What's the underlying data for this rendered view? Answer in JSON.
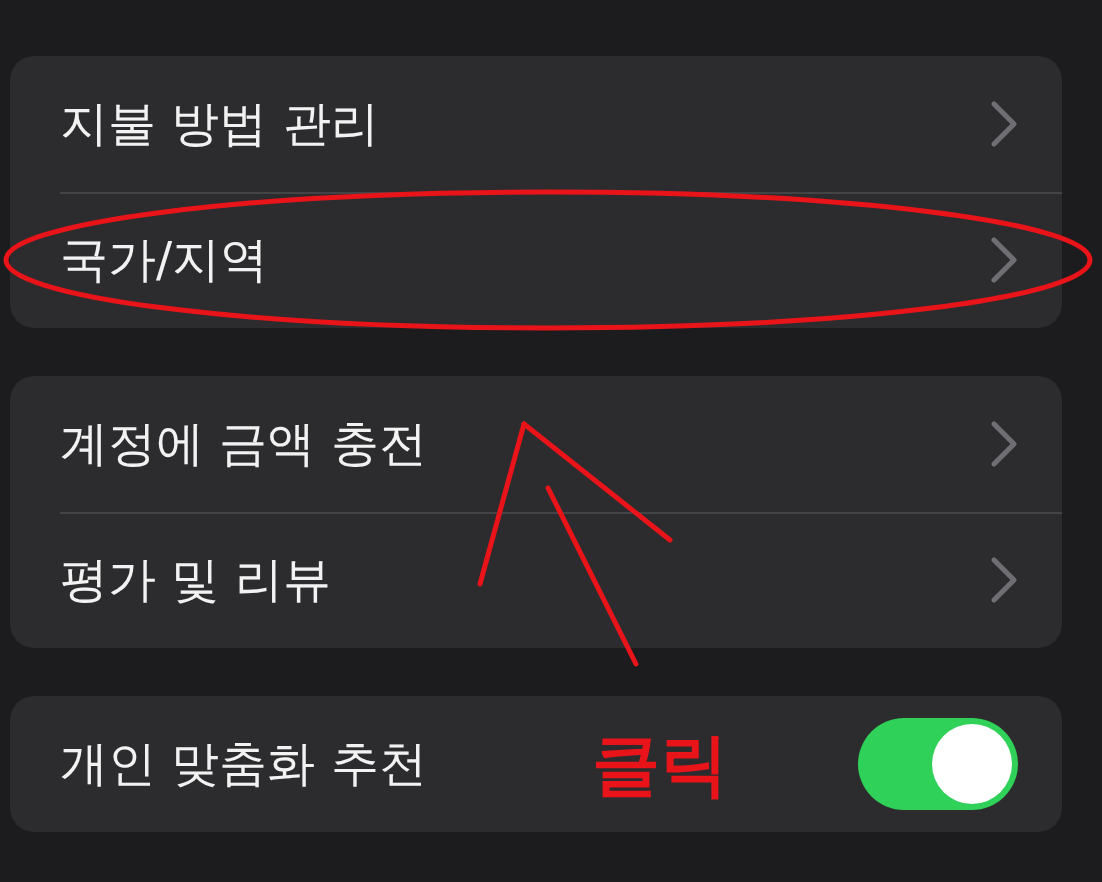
{
  "groups": [
    {
      "rows": [
        {
          "kind": "chevron",
          "label": "지불 방법 관리"
        },
        {
          "kind": "chevron",
          "label": "국가/지역"
        }
      ]
    },
    {
      "rows": [
        {
          "kind": "chevron",
          "label": "계정에 금액 충전"
        },
        {
          "kind": "chevron",
          "label": "평가 및 리뷰"
        }
      ]
    },
    {
      "rows": [
        {
          "kind": "toggle",
          "label": "개인 맞춤화 추천",
          "on": true
        }
      ]
    }
  ],
  "annotation": {
    "label": "클릭"
  }
}
